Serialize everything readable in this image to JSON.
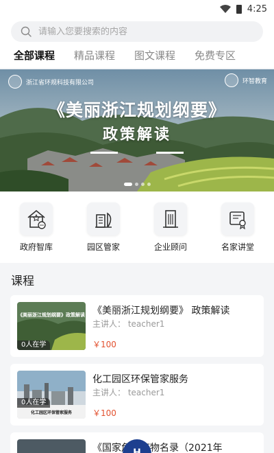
{
  "status": {
    "time": "4:25"
  },
  "search": {
    "placeholder": "请输入您要搜索的内容"
  },
  "tabs": [
    {
      "label": "全部课程",
      "active": true
    },
    {
      "label": "精品课程",
      "active": false
    },
    {
      "label": "图文课程",
      "active": false
    },
    {
      "label": "免费专区",
      "active": false
    }
  ],
  "banner": {
    "org_left": "浙江省环规科技有限公司",
    "org_right": "环智教育",
    "title_line1": "《美丽浙江规划纲要》",
    "title_line2": "政策解读"
  },
  "quick_links": [
    {
      "label": "政府智库",
      "icon": "gov-house-icon"
    },
    {
      "label": "园区管家",
      "icon": "park-building-icon"
    },
    {
      "label": "企业顾问",
      "icon": "office-tower-icon"
    },
    {
      "label": "名家讲堂",
      "icon": "certificate-icon"
    }
  ],
  "section": {
    "title": "课程"
  },
  "courses": [
    {
      "title": "《美丽浙江规划纲要》 政策解读",
      "speaker": "主讲人： teacher1",
      "price": "￥100",
      "learners": "0人在学",
      "thumb_caption": "《美丽浙江规划纲要》政策解读"
    },
    {
      "title": "化工园区环保管家服务",
      "speaker": "主讲人： teacher1",
      "price": "￥100",
      "learners": "0人在学",
      "thumb_caption": "化工园区环保管家服务"
    },
    {
      "title": "《国家危险废物名录（2021年",
      "speaker": "",
      "price": "",
      "learners": ""
    }
  ],
  "fab": {
    "label": "H"
  }
}
